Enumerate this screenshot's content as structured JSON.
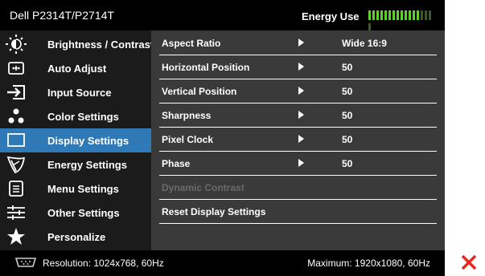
{
  "header": {
    "title": "Dell P2314T/P2714T",
    "energy_label": "Energy Use",
    "energy_level": 0.78
  },
  "sidebar": {
    "items": [
      {
        "label": "Brightness / Contrast",
        "icon": "brightness-icon",
        "active": false
      },
      {
        "label": "Auto Adjust",
        "icon": "auto-adjust-icon",
        "active": false
      },
      {
        "label": "Input Source",
        "icon": "input-source-icon",
        "active": false
      },
      {
        "label": "Color Settings",
        "icon": "color-settings-icon",
        "active": false
      },
      {
        "label": "Display Settings",
        "icon": "display-settings-icon",
        "active": true
      },
      {
        "label": "Energy Settings",
        "icon": "energy-leaf-icon",
        "active": false
      },
      {
        "label": "Menu Settings",
        "icon": "menu-settings-icon",
        "active": false
      },
      {
        "label": "Other Settings",
        "icon": "other-settings-icon",
        "active": false
      },
      {
        "label": "Personalize",
        "icon": "star-icon",
        "active": false
      }
    ]
  },
  "panel": {
    "rows": [
      {
        "label": "Aspect Ratio",
        "arrow": true,
        "value": "Wide 16:9",
        "enabled": true
      },
      {
        "label": "Horizontal Position",
        "arrow": true,
        "value": "50",
        "enabled": true
      },
      {
        "label": "Vertical Position",
        "arrow": true,
        "value": "50",
        "enabled": true
      },
      {
        "label": "Sharpness",
        "arrow": true,
        "value": "50",
        "enabled": true
      },
      {
        "label": "Pixel Clock",
        "arrow": true,
        "value": "50",
        "enabled": true
      },
      {
        "label": "Phase",
        "arrow": true,
        "value": "50",
        "enabled": true
      },
      {
        "label": "Dynamic Contrast",
        "arrow": false,
        "value": "",
        "enabled": false
      },
      {
        "label": "Reset Display Settings",
        "arrow": false,
        "value": "",
        "enabled": true
      }
    ]
  },
  "status": {
    "resolution": "Resolution: 1024x768, 60Hz",
    "maximum": "Maximum: 1920x1080, 60Hz",
    "icon": "vga-connector-icon"
  },
  "nav_buttons": [
    {
      "icon": "up-arrow-icon",
      "color": "#ffffff"
    },
    {
      "icon": "down-arrow-icon",
      "color": "#ffffff"
    },
    {
      "icon": "right-arrow-icon",
      "color": "#ffffff"
    },
    {
      "icon": "close-icon",
      "color": "#e8261e"
    }
  ],
  "colors": {
    "accent": "#2f79b6",
    "energy_green": "#5fd02a",
    "energy_dim": "#3a5a2a"
  }
}
